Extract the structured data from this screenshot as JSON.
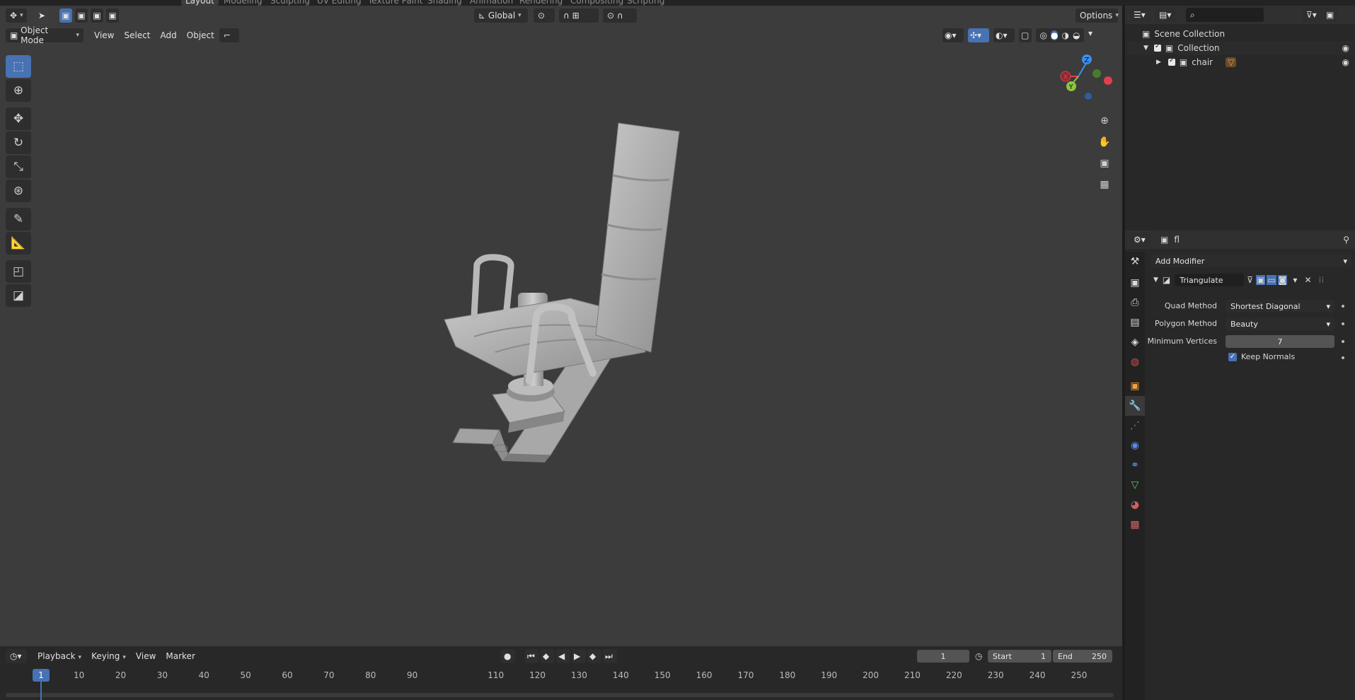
{
  "workspace_tabs": [
    "Layout",
    "Modeling",
    "Sculpting",
    "UV Editing",
    "Texture Paint",
    "Shading",
    "Animation",
    "Rendering",
    "Compositing",
    "Scripting"
  ],
  "header": {
    "mode": "Object Mode",
    "menus": [
      "View",
      "Select",
      "Add",
      "Object"
    ],
    "transform_orientation": "Global",
    "options": "Options"
  },
  "outliner": {
    "root": "Scene Collection",
    "collection": "Collection",
    "object": "chair",
    "search_placeholder": ""
  },
  "properties": {
    "object_name": "fl",
    "add_modifier": "Add Modifier",
    "modifier_name": "Triangulate",
    "quad_method_label": "Quad Method",
    "quad_method_value": "Shortest Diagonal",
    "polygon_method_label": "Polygon Method",
    "polygon_method_value": "Beauty",
    "min_vertices_label": "Minimum Vertices",
    "min_vertices_value": "7",
    "keep_normals_label": "Keep Normals",
    "keep_normals_checked": true
  },
  "timeline": {
    "menus": [
      "Playback",
      "Keying",
      "View",
      "Marker"
    ],
    "current_frame": "1",
    "start_label": "Start",
    "start_value": "1",
    "end_label": "End",
    "end_value": "250",
    "ticks": [
      "1",
      "10",
      "20",
      "30",
      "40",
      "50",
      "60",
      "70",
      "80",
      "90",
      "110",
      "120",
      "130",
      "140",
      "150",
      "160",
      "170",
      "180",
      "190",
      "200",
      "210",
      "220",
      "230",
      "240",
      "250"
    ]
  },
  "gizmo": {
    "x": "X",
    "y": "Y",
    "z": "Z"
  },
  "colors": {
    "accent": "#4772b3",
    "x_axis": "#e0404a",
    "y_axis": "#8cc63f",
    "z_axis": "#3b8ef0"
  }
}
